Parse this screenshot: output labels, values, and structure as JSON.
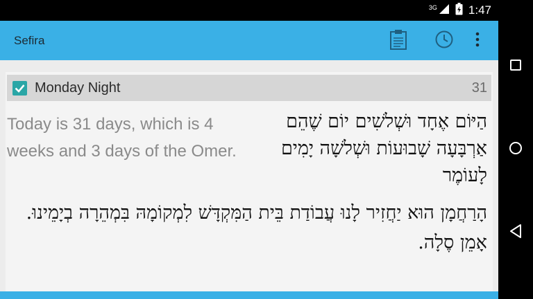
{
  "status_bar": {
    "network": "3G",
    "time": "1:47"
  },
  "app_bar": {
    "title": "Sefira",
    "actions": [
      {
        "icon": "clipboard-icon"
      },
      {
        "icon": "clock-icon"
      },
      {
        "icon": "more-vert-icon"
      }
    ]
  },
  "entry": {
    "checked": true,
    "day_label": "Monday Night",
    "day_number": "31",
    "english_text": "Today is 31 days, which is 4 weeks and 3 days of the Omer.",
    "hebrew_count": "הַיּוֹם אֶחָד וּשְׁלשִׁים יוֹם שֶׁהֵם אַרְבָּעָה שָׁבוּעוֹת וּשְׁלשָׁה יָמִים לָעוֹמֶר",
    "hebrew_prayer": "הָרַחֲמָן הוּא יַחֲזִיר לָנוּ עֲבוֹדַת בֵּית הַמִּקְדָּשׁ לִמְקוֹמָהּ בִּמְהֵרָה בְיָמֵינוּ. אָמֵן סֶלָה."
  },
  "colors": {
    "accent": "#3ab0e6",
    "checkbox": "#2aa6a6",
    "header_row": "#d6d6d6"
  },
  "nav_bar": {
    "buttons": [
      "recents-icon",
      "home-icon",
      "back-icon"
    ]
  }
}
